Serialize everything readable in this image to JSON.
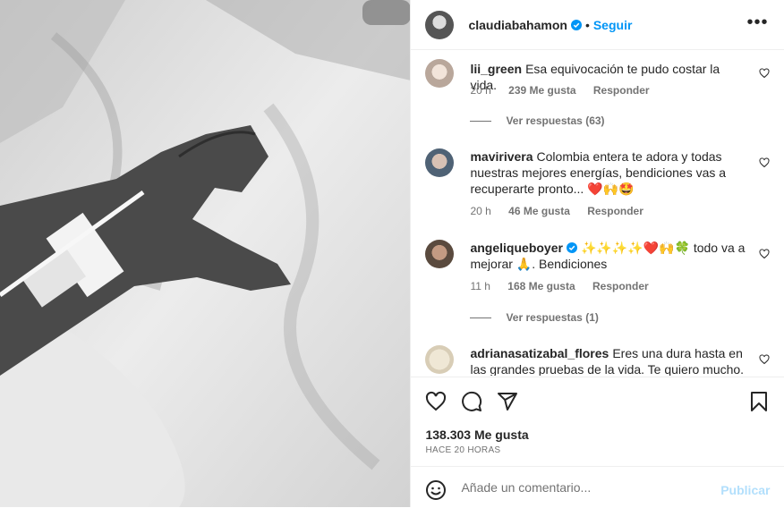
{
  "post_author": "claudiabahamon",
  "follow_label": "Seguir",
  "separator": "•",
  "more_icon": "more-horizontal-icon",
  "comments": [
    {
      "user": "lii_green",
      "text": "Esa equivocación te pudo costar la vida.",
      "time": "20 h",
      "likes": "239 Me gusta",
      "reply": "Responder",
      "view_replies": "Ver respuestas (63)"
    },
    {
      "user": "mavirivera",
      "text": "Colombia entera te adora y todas nuestras mejores energías, bendiciones vas a recuperarte pronto... ❤️🙌🤩",
      "time": "20 h",
      "likes": "46 Me gusta",
      "reply": "Responder"
    },
    {
      "user": "angeliqueboyer",
      "text": "✨✨✨✨❤️🙌🍀 todo va a mejorar 🙏. Bendiciones",
      "time": "11 h",
      "likes": "168 Me gusta",
      "reply": "Responder",
      "view_replies": "Ver respuestas (1)"
    },
    {
      "user": "adrianasatizabal_flores",
      "text": "Eres una dura hasta en las grandes pruebas de la vida. Te quiero mucho. Eres"
    }
  ],
  "like_count": "138.303 Me gusta",
  "posted_time": "HACE 20 HORAS",
  "comment_input": {
    "placeholder": "Añade un comentario..."
  },
  "publish_label": "Publicar",
  "colors": {
    "accent": "#0095f6",
    "like_red": "#ed4956",
    "muted": "#737373",
    "publish_disabled": "#b2dffc"
  }
}
